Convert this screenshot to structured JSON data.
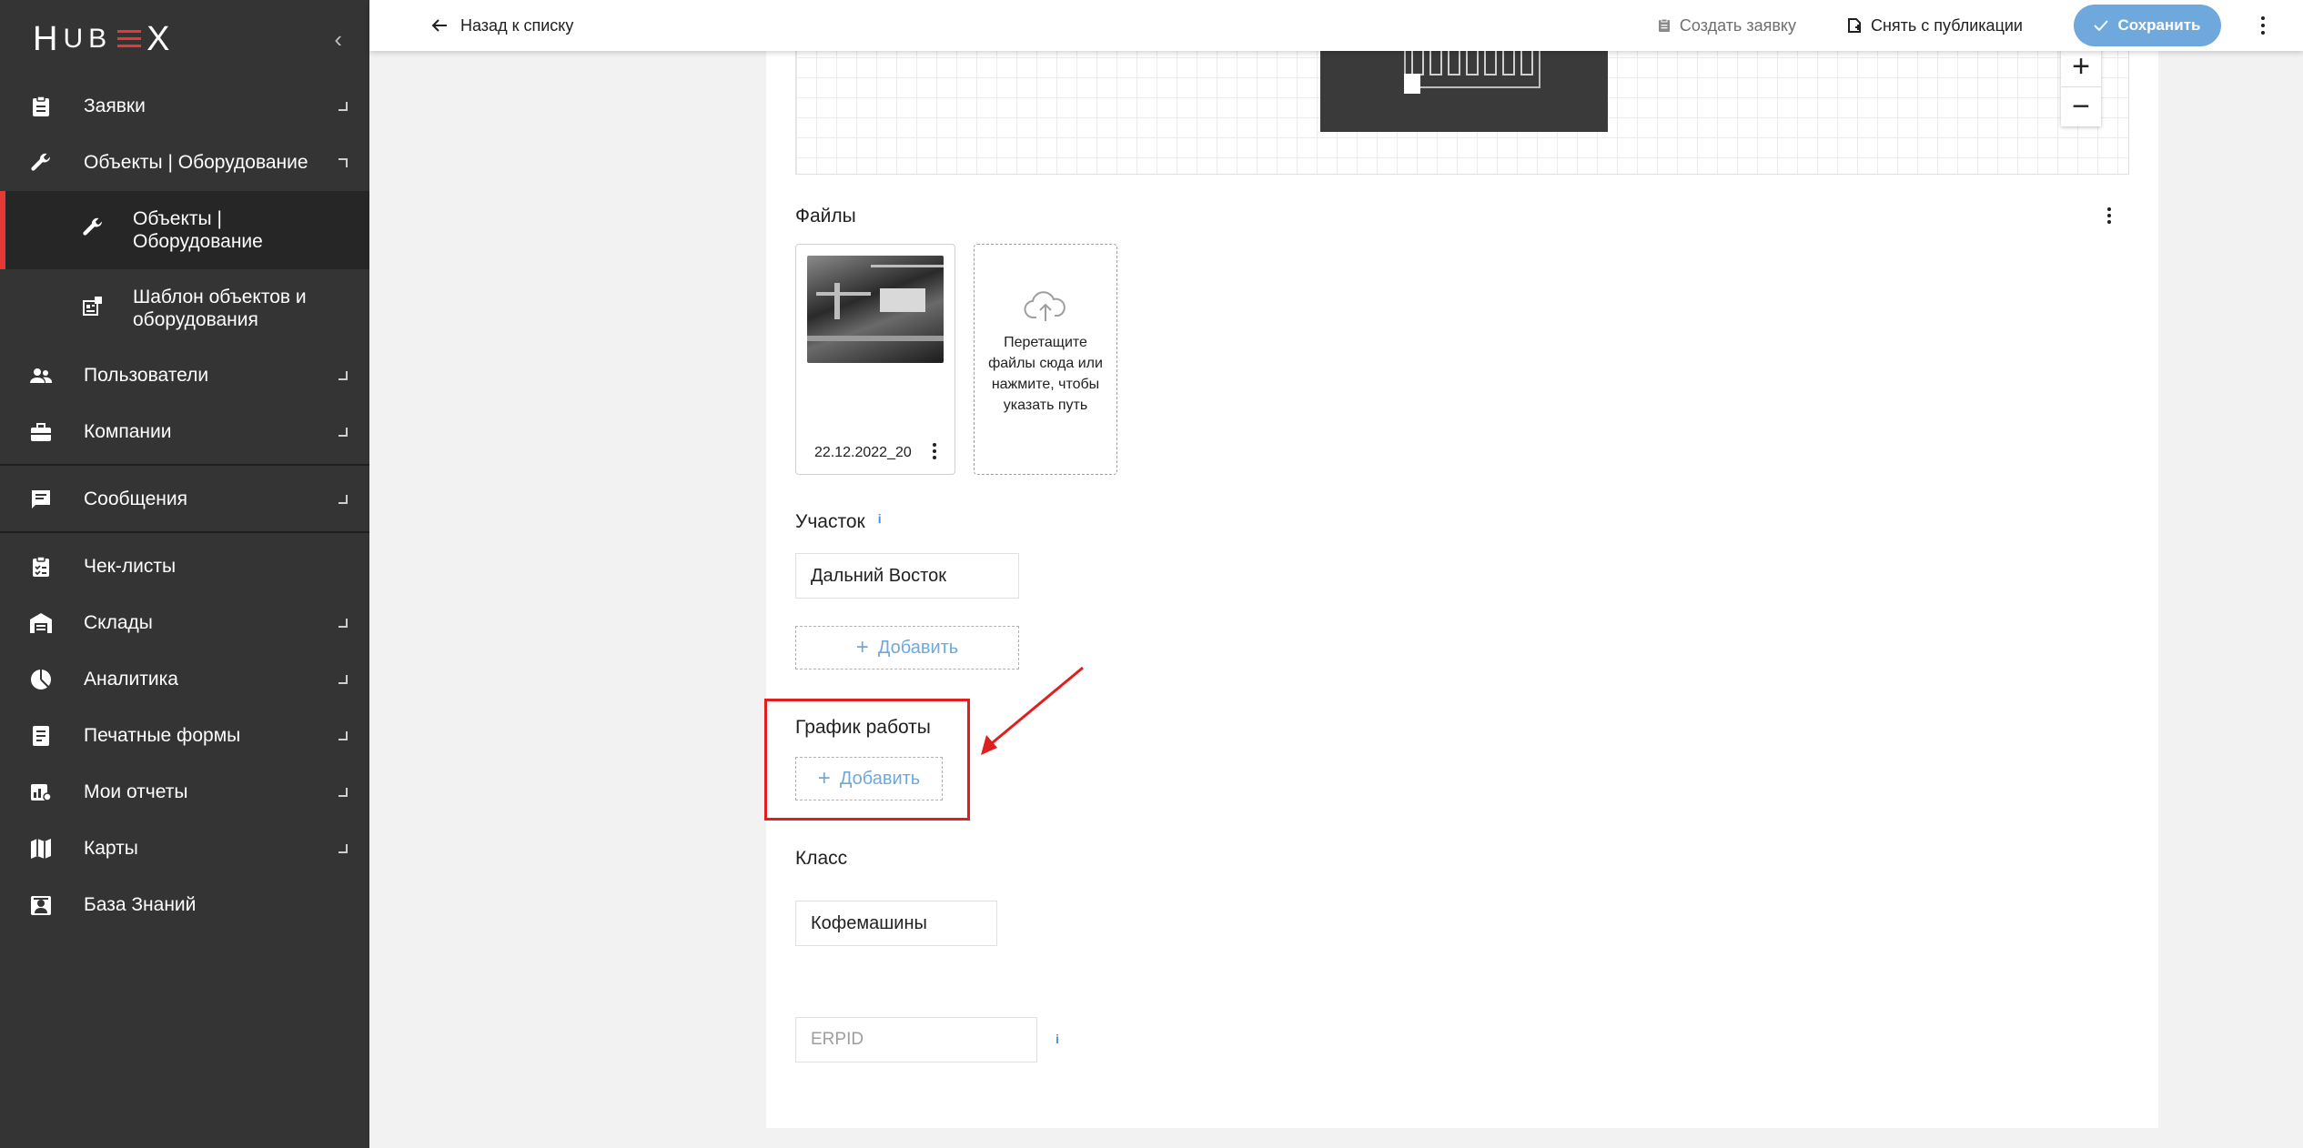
{
  "app": {
    "logo": "HUBEX"
  },
  "sidebar": {
    "items": [
      {
        "label": "Заявки",
        "icon": "clipboard-icon"
      },
      {
        "label": "Объекты | Оборудование",
        "icon": "wrench-icon"
      },
      {
        "label": "Объекты | Оборудование",
        "icon": "wrench-icon"
      },
      {
        "label": "Шаблон объектов и оборудования",
        "icon": "template-icon"
      },
      {
        "label": "Пользователи",
        "icon": "users-icon"
      },
      {
        "label": "Компании",
        "icon": "briefcase-icon"
      },
      {
        "label": "Сообщения",
        "icon": "message-icon"
      },
      {
        "label": "Чек-листы",
        "icon": "checklist-icon"
      },
      {
        "label": "Склады",
        "icon": "warehouse-icon"
      },
      {
        "label": "Аналитика",
        "icon": "pie-chart-icon"
      },
      {
        "label": "Печатные формы",
        "icon": "print-form-icon"
      },
      {
        "label": "Мои отчеты",
        "icon": "report-icon"
      },
      {
        "label": "Карты",
        "icon": "map-icon"
      },
      {
        "label": "База Знаний",
        "icon": "knowledge-base-icon"
      }
    ]
  },
  "topbar": {
    "back_label": "Назад к списку",
    "create_request_label": "Создать заявку",
    "unpublish_label": "Снять с публикации",
    "save_label": "Сохранить"
  },
  "map": {
    "zoom_in": "+",
    "zoom_out": "−"
  },
  "files": {
    "title": "Файлы",
    "items": [
      {
        "name": "22.12.2022_20"
      }
    ],
    "dropzone_text": "Перетащите файлы сюда или нажмите, чтобы указать путь"
  },
  "site": {
    "title": "Участок",
    "info": "i",
    "value": "Дальний Восток",
    "add_label": "Добавить"
  },
  "schedule": {
    "title": "График работы",
    "add_label": "Добавить"
  },
  "class_field": {
    "title": "Класс",
    "value": "Кофемашины"
  },
  "erpid": {
    "placeholder": "ERPID",
    "info": "i"
  },
  "colors": {
    "accent": "#6fa8dc",
    "sidebar_bg": "#343434",
    "active_marker": "#e53935",
    "highlight": "#e01e1e"
  }
}
